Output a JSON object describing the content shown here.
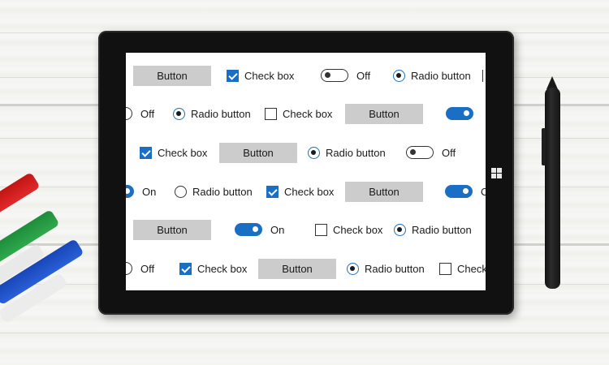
{
  "screen": {
    "rows": [
      {
        "controls": [
          {
            "kind": "button",
            "label": "Button"
          },
          {
            "kind": "checkbox",
            "label": "Check box",
            "checked": true
          },
          {
            "kind": "toggle",
            "label": "Off",
            "on": false
          },
          {
            "kind": "radio",
            "label": "Radio button",
            "selected": true
          }
        ]
      },
      {
        "controls": [
          {
            "kind": "toggle",
            "label": "Off",
            "on": false
          },
          {
            "kind": "radio",
            "label": "Radio button",
            "selected": true
          },
          {
            "kind": "checkbox",
            "label": "Check box",
            "checked": false
          },
          {
            "kind": "button",
            "label": "Button"
          },
          {
            "kind": "toggle",
            "label": "",
            "on": true
          }
        ]
      },
      {
        "controls": [
          {
            "kind": "checkbox",
            "label": "Check box",
            "checked": true
          },
          {
            "kind": "button",
            "label": "Button"
          },
          {
            "kind": "radio",
            "label": "Radio button",
            "selected": true
          },
          {
            "kind": "toggle",
            "label": "Off",
            "on": false
          }
        ]
      },
      {
        "controls": [
          {
            "kind": "toggle",
            "label": "On",
            "on": true
          },
          {
            "kind": "radio",
            "label": "Radio button",
            "selected": false
          },
          {
            "kind": "checkbox",
            "label": "Check box",
            "checked": true
          },
          {
            "kind": "button",
            "label": "Button"
          },
          {
            "kind": "toggle",
            "label": "O",
            "on": true
          }
        ]
      },
      {
        "controls": [
          {
            "kind": "button",
            "label": "Button"
          },
          {
            "kind": "toggle",
            "label": "On",
            "on": true
          },
          {
            "kind": "checkbox",
            "label": "Check box",
            "checked": false
          },
          {
            "kind": "radio",
            "label": "Radio button",
            "selected": true
          }
        ]
      },
      {
        "controls": [
          {
            "kind": "toggle",
            "label": "Off",
            "on": false
          },
          {
            "kind": "checkbox",
            "label": "Check box",
            "checked": true
          },
          {
            "kind": "button",
            "label": "Button"
          },
          {
            "kind": "radio",
            "label": "Radio button",
            "selected": true
          },
          {
            "kind": "checkbox",
            "label": "Check",
            "checked": false
          }
        ]
      }
    ]
  },
  "colors": {
    "accent": "#1a6fc4",
    "button_bg": "#cccccc",
    "tablet_bezel": "#111111"
  },
  "icons": {
    "windows_button": "windows-logo-icon"
  }
}
